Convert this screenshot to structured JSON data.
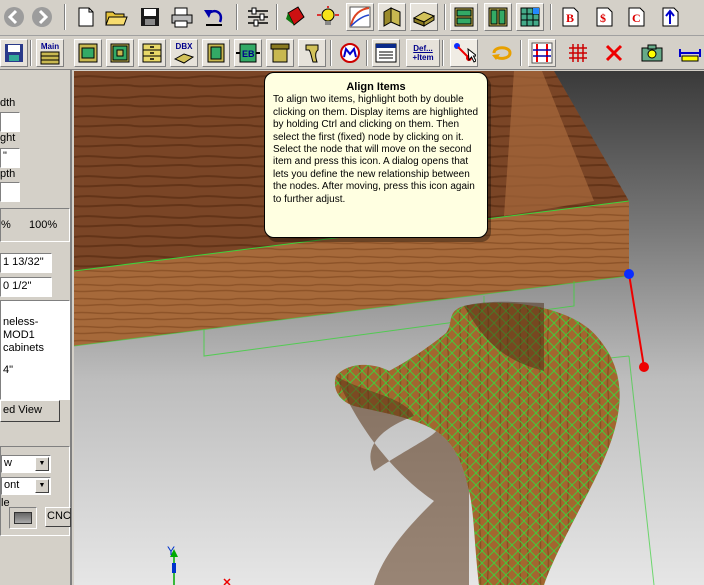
{
  "toolbar1": {
    "icons": [
      "back-icon",
      "forward-icon",
      "new-document-icon",
      "open-folder-icon",
      "save-icon",
      "print-icon",
      "undo-icon",
      "settings-sliders-icon",
      "paint-icon",
      "light-bulb-icon",
      "curve-icon",
      "panel-icon",
      "drawer-icon",
      "cabinet-icon",
      "cabinets-icon",
      "grid-icon",
      "b-report-icon",
      "dollar-report-icon",
      "c-report-icon",
      "up-arrow-icon"
    ],
    "labels": {
      "b_report": "B",
      "dollar_report": "$",
      "c_report": "C"
    }
  },
  "toolbar2": {
    "main_label": "Main",
    "dbx_label": "DBX",
    "eb_label": "EB",
    "def_label": "Def...",
    "item_label": "+Item"
  },
  "left_panel": {
    "width_label": "dth",
    "height_label": "ght",
    "height_value": "\"",
    "depth_label": "pth",
    "percent_left": "%",
    "percent_right": "100%",
    "dim_a": "1 13/32\"",
    "dim_b": "0 1/2\"",
    "group_line1": "neless-MOD1",
    "group_line2": "cabinets",
    "group_line3": "4\"",
    "view_button": "ed View",
    "select1": "w",
    "select2": "ont",
    "style_label": "le",
    "cnc_button": "CNC"
  },
  "tooltip": {
    "title": "Align Items",
    "body": "To align two items, highlight both by double clicking on them. Display items are highlighted by holding Ctrl and clicking on them. Then select the first (fixed) node by clicking on it. Select the node that will move on the second item and press this icon. A dialog opens that lets you define the new relationship between the nodes. After moving, press this icon again to further adjust."
  },
  "viewport": {
    "axis_label": "Y"
  },
  "colors": {
    "wood_top": "#7a4526",
    "wood_front": "#b0703e",
    "leg": "#a2672f",
    "grid": "#3cd23c",
    "node_blue": "#0a2cff",
    "node_red": "#ee0000"
  }
}
